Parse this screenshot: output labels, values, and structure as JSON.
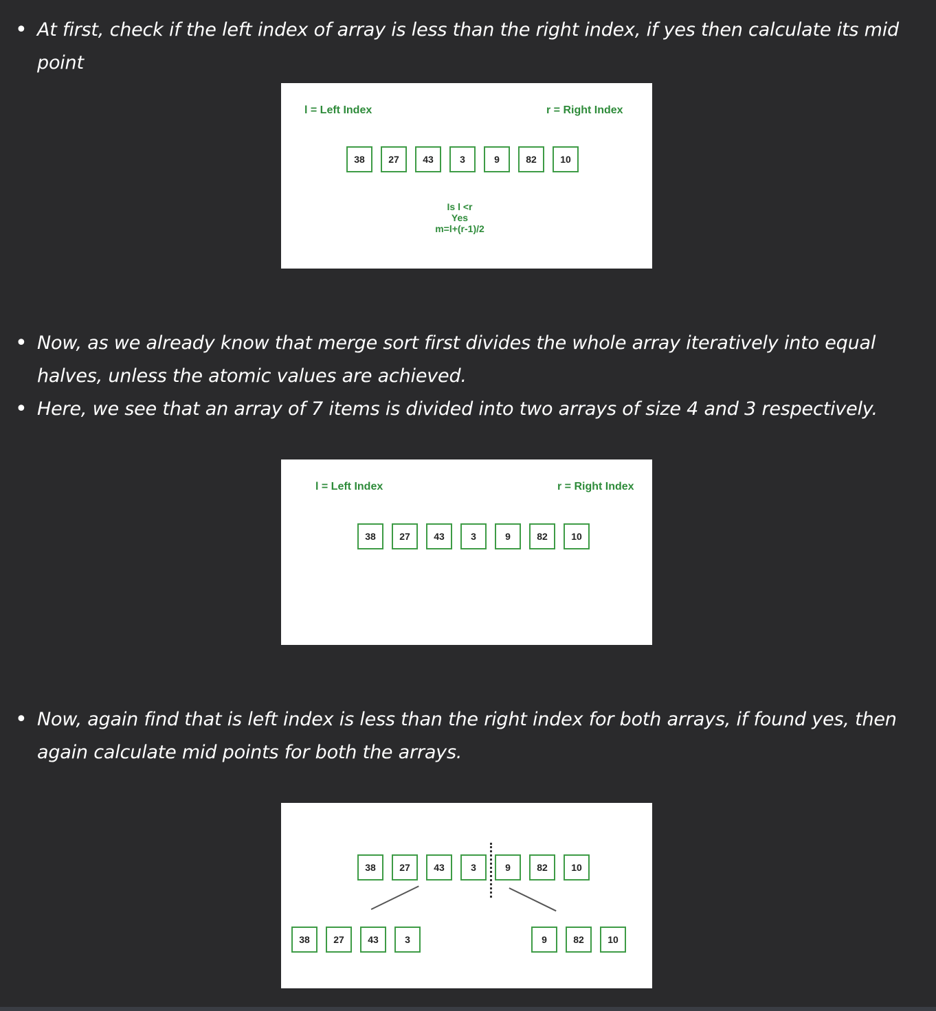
{
  "bullets": [
    "At first, check if the left index of array is less than the right index, if yes then calculate its mid point",
    "Now, as we already know that merge sort first divides the whole array iteratively into equal halves, unless the atomic values are achieved.",
    "Here, we see that an array of 7 items is divided into two arrays of size 4 and 3 respectively.",
    "Now, again find that is left index is less than the right index for both arrays, if found yes, then again calculate mid points for both the arrays."
  ],
  "bullet_symbol": "•",
  "figure1": {
    "left_label": "l = Left Index",
    "right_label": "r = Right Index",
    "array": [
      "38",
      "27",
      "43",
      "3",
      "9",
      "82",
      "10"
    ],
    "note": [
      "Is l <r",
      "Yes",
      "m=l+(r-1)/2"
    ]
  },
  "figure2": {
    "left_label": "l = Left Index",
    "right_label": "r = Right Index",
    "array": [
      "38",
      "27",
      "43",
      "3",
      "9",
      "82",
      "10"
    ]
  },
  "figure3": {
    "array": [
      "38",
      "27",
      "43",
      "3",
      "9",
      "82",
      "10"
    ],
    "left_half": [
      "38",
      "27",
      "43",
      "3"
    ],
    "right_half": [
      "9",
      "82",
      "10"
    ]
  },
  "colors": {
    "background": "#2a2a2c",
    "text": "#ffffff",
    "accent_green": "#2e8b3a"
  }
}
